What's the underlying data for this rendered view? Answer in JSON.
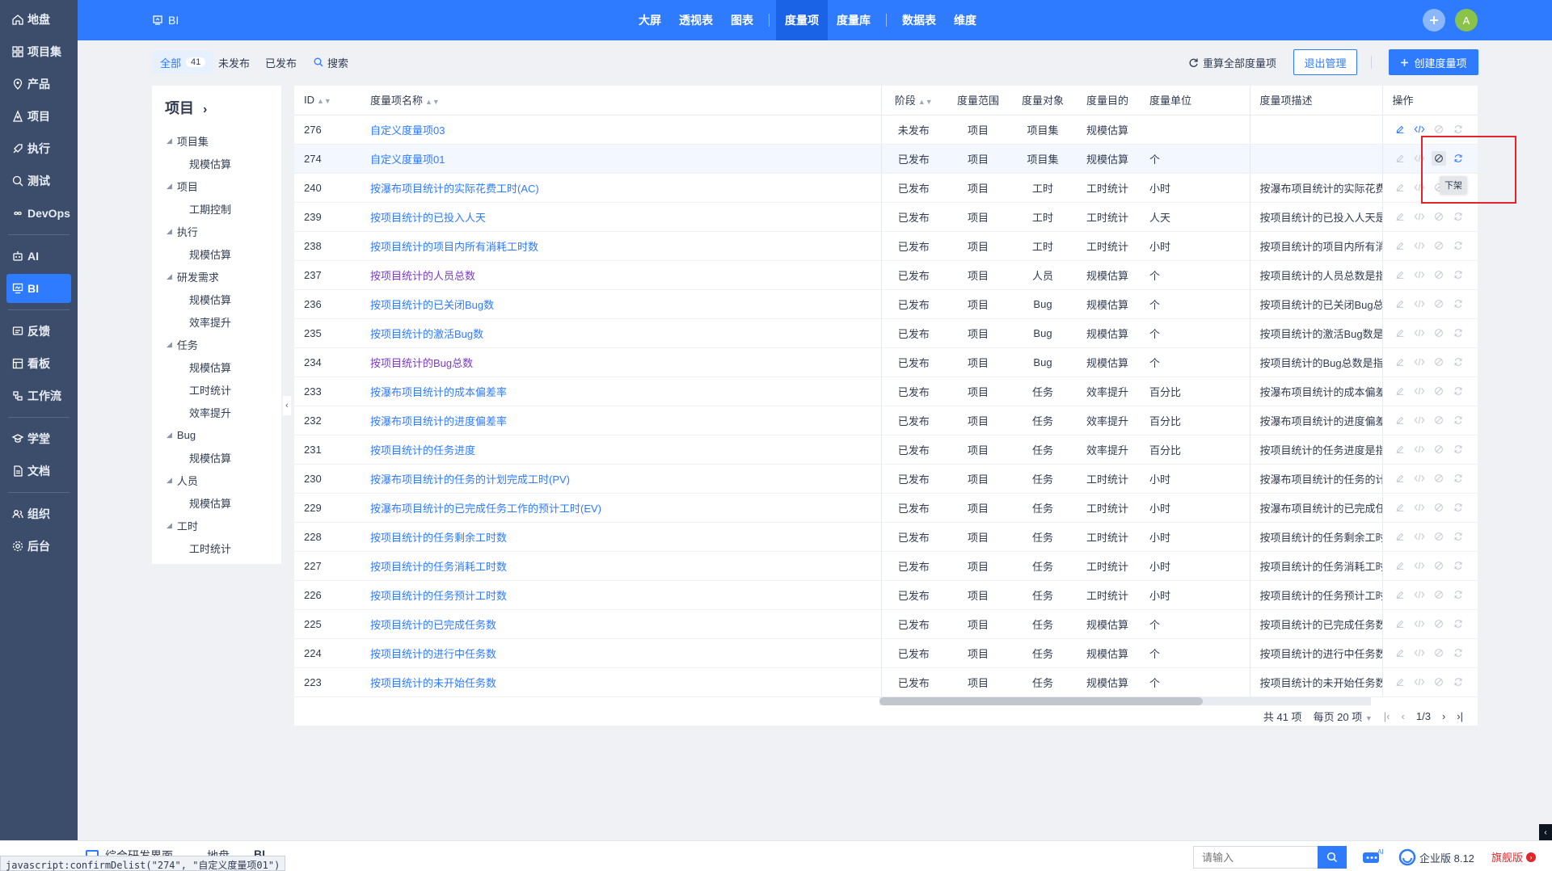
{
  "nav": {
    "items": [
      {
        "label": "地盘",
        "icon": "home-icon"
      },
      {
        "label": "项目集",
        "icon": "grid-icon"
      },
      {
        "label": "产品",
        "icon": "location-icon"
      },
      {
        "label": "项目",
        "icon": "project-icon"
      },
      {
        "label": "执行",
        "icon": "rocket-icon"
      },
      {
        "label": "测试",
        "icon": "test-icon"
      },
      {
        "label": "DevOps",
        "icon": "infinity-icon"
      },
      {
        "label": "AI",
        "icon": "robot-icon"
      },
      {
        "label": "BI",
        "icon": "bi-icon",
        "active": true
      },
      {
        "label": "反馈",
        "icon": "feedback-icon"
      },
      {
        "label": "看板",
        "icon": "board-icon"
      },
      {
        "label": "工作流",
        "icon": "workflow-icon"
      },
      {
        "label": "学堂",
        "icon": "school-icon"
      },
      {
        "label": "文档",
        "icon": "doc-icon"
      },
      {
        "label": "组织",
        "icon": "org-icon"
      },
      {
        "label": "后台",
        "icon": "gear-icon"
      }
    ]
  },
  "header": {
    "app_name": "BI",
    "tabs": [
      "大屏",
      "透视表",
      "图表",
      "度量项",
      "度量库",
      "数据表",
      "维度"
    ],
    "active_tab": "度量项",
    "avatar_initial": "A"
  },
  "filters": {
    "all_label": "全部",
    "all_count": "41",
    "unpublished_label": "未发布",
    "published_label": "已发布",
    "search_label": "搜索"
  },
  "actions": {
    "recalc_label": "重算全部度量项",
    "exit_label": "退出管理",
    "create_label": "创建度量项"
  },
  "tree": {
    "title": "项目",
    "groups": [
      {
        "label": "项目集",
        "children": [
          "规模估算"
        ]
      },
      {
        "label": "项目",
        "children": [
          "工期控制"
        ]
      },
      {
        "label": "执行",
        "children": [
          "规模估算"
        ]
      },
      {
        "label": "研发需求",
        "children": [
          "规模估算",
          "效率提升"
        ]
      },
      {
        "label": "任务",
        "children": [
          "规模估算",
          "工时统计",
          "效率提升"
        ]
      },
      {
        "label": "Bug",
        "children": [
          "规模估算"
        ]
      },
      {
        "label": "人员",
        "children": [
          "规模估算"
        ]
      },
      {
        "label": "工时",
        "children": [
          "工时统计"
        ]
      }
    ]
  },
  "table": {
    "headers": {
      "id": "ID",
      "name": "度量项名称",
      "stage": "阶段",
      "scope": "度量范围",
      "object": "度量对象",
      "purpose": "度量目的",
      "unit": "度量单位",
      "desc": "度量项描述",
      "ops": "操作"
    },
    "rows": [
      {
        "id": "276",
        "name": "自定义度量项03",
        "stage": "未发布",
        "scope": "项目",
        "object": "项目集",
        "purpose": "规模估算",
        "unit": "",
        "desc": "",
        "visited": false
      },
      {
        "id": "274",
        "name": "自定义度量项01",
        "stage": "已发布",
        "scope": "项目",
        "object": "项目集",
        "purpose": "规模估算",
        "unit": "个",
        "desc": "",
        "visited": false
      },
      {
        "id": "240",
        "name": "按瀑布项目统计的实际花费工时(AC)",
        "stage": "已发布",
        "scope": "项目",
        "object": "工时",
        "purpose": "工时统计",
        "unit": "小时",
        "desc": "按瀑布项目统计的实际花费",
        "visited": false
      },
      {
        "id": "239",
        "name": "按项目统计的已投入人天",
        "stage": "已发布",
        "scope": "项目",
        "object": "工时",
        "purpose": "工时统计",
        "unit": "人天",
        "desc": "按项目统计的已投入人天是",
        "visited": false
      },
      {
        "id": "238",
        "name": "按项目统计的项目内所有消耗工时数",
        "stage": "已发布",
        "scope": "项目",
        "object": "工时",
        "purpose": "工时统计",
        "unit": "小时",
        "desc": "按项目统计的项目内所有消",
        "visited": false
      },
      {
        "id": "237",
        "name": "按项目统计的人员总数",
        "stage": "已发布",
        "scope": "项目",
        "object": "人员",
        "purpose": "规模估算",
        "unit": "个",
        "desc": "按项目统计的人员总数是指",
        "visited": true
      },
      {
        "id": "236",
        "name": "按项目统计的已关闭Bug数",
        "stage": "已发布",
        "scope": "项目",
        "object": "Bug",
        "purpose": "规模估算",
        "unit": "个",
        "desc": "按项目统计的已关闭Bug总",
        "visited": false
      },
      {
        "id": "235",
        "name": "按项目统计的激活Bug数",
        "stage": "已发布",
        "scope": "项目",
        "object": "Bug",
        "purpose": "规模估算",
        "unit": "个",
        "desc": "按项目统计的激活Bug数是",
        "visited": false
      },
      {
        "id": "234",
        "name": "按项目统计的Bug总数",
        "stage": "已发布",
        "scope": "项目",
        "object": "Bug",
        "purpose": "规模估算",
        "unit": "个",
        "desc": "按项目统计的Bug总数是指",
        "visited": true
      },
      {
        "id": "233",
        "name": "按瀑布项目统计的成本偏差率",
        "stage": "已发布",
        "scope": "项目",
        "object": "任务",
        "purpose": "效率提升",
        "unit": "百分比",
        "desc": "按瀑布项目统计的成本偏差",
        "visited": false
      },
      {
        "id": "232",
        "name": "按瀑布项目统计的进度偏差率",
        "stage": "已发布",
        "scope": "项目",
        "object": "任务",
        "purpose": "效率提升",
        "unit": "百分比",
        "desc": "按瀑布项目统计的进度偏差",
        "visited": false
      },
      {
        "id": "231",
        "name": "按项目统计的任务进度",
        "stage": "已发布",
        "scope": "项目",
        "object": "任务",
        "purpose": "效率提升",
        "unit": "百分比",
        "desc": "按项目统计的任务进度是指",
        "visited": false
      },
      {
        "id": "230",
        "name": "按瀑布项目统计的任务的计划完成工时(PV)",
        "stage": "已发布",
        "scope": "项目",
        "object": "任务",
        "purpose": "工时统计",
        "unit": "小时",
        "desc": "按瀑布项目统计的任务的计",
        "visited": false
      },
      {
        "id": "229",
        "name": "按瀑布项目统计的已完成任务工作的预计工时(EV)",
        "stage": "已发布",
        "scope": "项目",
        "object": "任务",
        "purpose": "工时统计",
        "unit": "小时",
        "desc": "按瀑布项目统计的已完成任",
        "visited": false
      },
      {
        "id": "228",
        "name": "按项目统计的任务剩余工时数",
        "stage": "已发布",
        "scope": "项目",
        "object": "任务",
        "purpose": "工时统计",
        "unit": "小时",
        "desc": "按项目统计的任务剩余工时",
        "visited": false
      },
      {
        "id": "227",
        "name": "按项目统计的任务消耗工时数",
        "stage": "已发布",
        "scope": "项目",
        "object": "任务",
        "purpose": "工时统计",
        "unit": "小时",
        "desc": "按项目统计的任务消耗工时",
        "visited": false
      },
      {
        "id": "226",
        "name": "按项目统计的任务预计工时数",
        "stage": "已发布",
        "scope": "项目",
        "object": "任务",
        "purpose": "工时统计",
        "unit": "小时",
        "desc": "按项目统计的任务预计工时",
        "visited": false
      },
      {
        "id": "225",
        "name": "按项目统计的已完成任务数",
        "stage": "已发布",
        "scope": "项目",
        "object": "任务",
        "purpose": "规模估算",
        "unit": "个",
        "desc": "按项目统计的已完成任务数",
        "visited": false
      },
      {
        "id": "224",
        "name": "按项目统计的进行中任务数",
        "stage": "已发布",
        "scope": "项目",
        "object": "任务",
        "purpose": "规模估算",
        "unit": "个",
        "desc": "按项目统计的进行中任务数",
        "visited": false
      },
      {
        "id": "223",
        "name": "按项目统计的未开始任务数",
        "stage": "已发布",
        "scope": "项目",
        "object": "任务",
        "purpose": "规模估算",
        "unit": "个",
        "desc": "按项目统计的未开始任务数",
        "visited": false
      }
    ]
  },
  "pager": {
    "total": "共 41 项",
    "per_page": "每页 20 项",
    "page": "1/3"
  },
  "tooltip": "下架",
  "bottom": {
    "tabs": [
      "综合研发界面",
      "地盘",
      "BI"
    ],
    "active_tab": "BI",
    "search_placeholder": "请输入",
    "edition": "企业版 8.12",
    "flagship": "旗舰版",
    "status_text": "javascript:confirmDelist(\"274\", \"自定义度量项01\")"
  },
  "colors": {
    "accent": "#2e7bff",
    "nav_bg": "#3b4d6b",
    "visited_link": "#7a3cc7",
    "highlight_box": "#e0262a"
  }
}
